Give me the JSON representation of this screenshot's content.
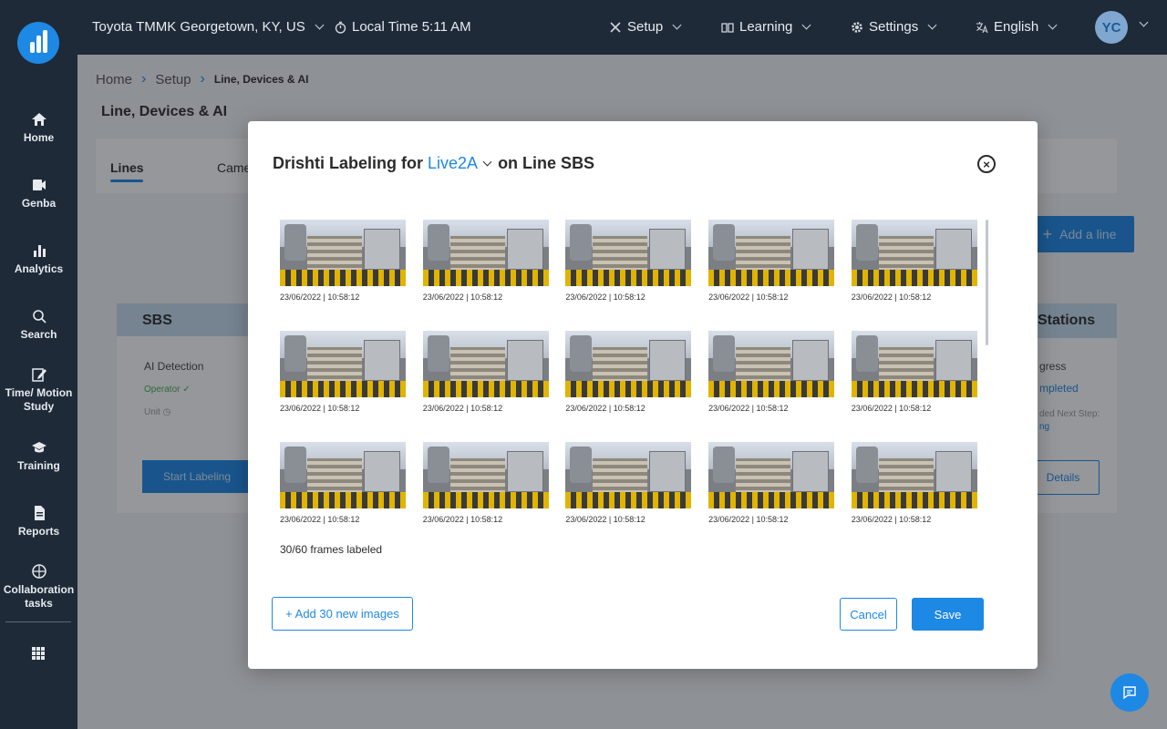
{
  "sidebar": {
    "items": [
      {
        "label": "Home",
        "icon": "home-icon"
      },
      {
        "label": "Genba",
        "icon": "video-camera-icon"
      },
      {
        "label": "Analytics",
        "icon": "bar-chart-icon"
      },
      {
        "label": "Search",
        "icon": "search-icon"
      },
      {
        "label": "Time/ Motion Study",
        "icon": "edit-icon"
      },
      {
        "label": "Training",
        "icon": "graduation-cap-icon"
      },
      {
        "label": "Reports",
        "icon": "document-icon"
      },
      {
        "label": "Collaboration tasks",
        "icon": "target-icon"
      }
    ]
  },
  "topbar": {
    "location": "Toyota TMMK Georgetown, KY, US",
    "local_time": "Local Time 5:11 AM",
    "setup": "Setup",
    "learning": "Learning",
    "settings": "Settings",
    "language": "English",
    "avatar": "YC"
  },
  "breadcrumb": {
    "home": "Home",
    "setup": "Setup",
    "current": "Line, Devices & AI"
  },
  "page": {
    "title": "Line, Devices & AI",
    "tabs": [
      "Lines",
      "Came"
    ],
    "add_line": "Add a line"
  },
  "line_card": {
    "name": "SBS",
    "ai_detection": "AI Detection",
    "operator": "Operator",
    "unit": "Unit",
    "start_labeling": "Start Labeling"
  },
  "station_card": {
    "title": "Stations",
    "progress": "gress",
    "completed": "mpleted",
    "next_step": "ded Next Step:",
    "next_value": "ng",
    "details": "Details"
  },
  "modal": {
    "title_prefix": "Drishti Labeling for",
    "selected_station": "Live2A",
    "title_suffix": "on Line SBS",
    "frames": [
      "23/06/2022 | 10:58:12",
      "23/06/2022 | 10:58:12",
      "23/06/2022 | 10:58:12",
      "23/06/2022 | 10:58:12",
      "23/06/2022 | 10:58:12",
      "23/06/2022 | 10:58:12",
      "23/06/2022 | 10:58:12",
      "23/06/2022 | 10:58:12",
      "23/06/2022 | 10:58:12",
      "23/06/2022 | 10:58:12",
      "23/06/2022 | 10:58:12",
      "23/06/2022 | 10:58:12",
      "23/06/2022 | 10:58:12",
      "23/06/2022 | 10:58:12",
      "23/06/2022 | 10:58:12"
    ],
    "frames_labeled": "30/60 frames labeled",
    "add_images": "+ Add 30 new images",
    "cancel": "Cancel",
    "save": "Save"
  },
  "colors": {
    "accent": "#1e88e5",
    "sidebar_bg": "#1e2a38"
  }
}
